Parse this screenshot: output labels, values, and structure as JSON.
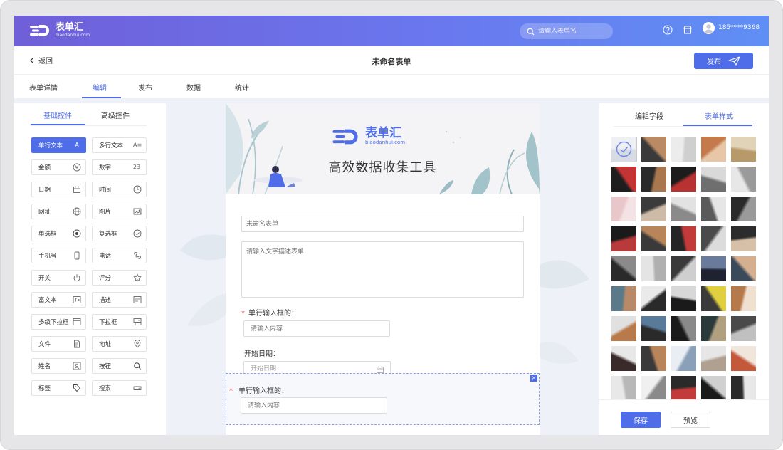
{
  "header": {
    "logo_cn": "表单汇",
    "logo_en": "biaodanhui.com",
    "search_placeholder": "请输入表单名",
    "user_phone": "185****9368"
  },
  "subbar": {
    "back_label": "返回",
    "form_title": "未命名表单",
    "publish_label": "发布"
  },
  "tabs": [
    {
      "label": "表单详情"
    },
    {
      "label": "编辑"
    },
    {
      "label": "发布"
    },
    {
      "label": "数据"
    },
    {
      "label": "统计"
    }
  ],
  "left_panel": {
    "tab_basic": "基础控件",
    "tab_advanced": "高级控件",
    "fields": [
      {
        "label": "单行文本",
        "icon": "A"
      },
      {
        "label": "多行文本",
        "icon": "A≡"
      },
      {
        "label": "金额",
        "icon": "¥"
      },
      {
        "label": "数字",
        "icon": "23"
      },
      {
        "label": "日期",
        "icon": "calendar-icon"
      },
      {
        "label": "时间",
        "icon": "clock-icon"
      },
      {
        "label": "网址",
        "icon": "globe-icon"
      },
      {
        "label": "图片",
        "icon": "image-icon"
      },
      {
        "label": "单选框",
        "icon": "radio-icon"
      },
      {
        "label": "复选框",
        "icon": "check-circle-icon"
      },
      {
        "label": "手机号",
        "icon": "mobile-icon"
      },
      {
        "label": "电话",
        "icon": "phone-icon"
      },
      {
        "label": "开关",
        "icon": "power-icon"
      },
      {
        "label": "评分",
        "icon": "star-icon"
      },
      {
        "label": "富文本",
        "icon": "richtext-icon"
      },
      {
        "label": "描述",
        "icon": "list-icon"
      },
      {
        "label": "多级下拉框",
        "icon": "multilevel-icon"
      },
      {
        "label": "下拉框",
        "icon": "dropdown-icon"
      },
      {
        "label": "文件",
        "icon": "file-icon"
      },
      {
        "label": "地址",
        "icon": "location-icon"
      },
      {
        "label": "姓名",
        "icon": "person-icon"
      },
      {
        "label": "按钮",
        "icon": "search-icon"
      },
      {
        "label": "标签",
        "icon": "tag-icon"
      },
      {
        "label": "搜索",
        "icon": "searchbox-icon"
      }
    ]
  },
  "canvas": {
    "banner_logo_cn": "表单汇",
    "banner_logo_en": "biaodanhui.com",
    "banner_slogan": "高效数据收集工具",
    "title_placeholder": "未命名表单",
    "desc_placeholder": "请输入文字描述表单",
    "q1_label": "单行输入框的：",
    "q1_placeholder": "请输入内容",
    "q2_label": "开始日期：",
    "q2_placeholder": "开始日期",
    "q3_label": "单行输入框的：",
    "q3_placeholder": "请输入内容",
    "close_glyph": "×"
  },
  "right_panel": {
    "tab_fields": "编辑字段",
    "tab_style": "表单样式",
    "save_label": "保存",
    "preview_label": "预览"
  },
  "colors": {
    "accent": "#4f6de8",
    "required": "#e84d4d"
  }
}
